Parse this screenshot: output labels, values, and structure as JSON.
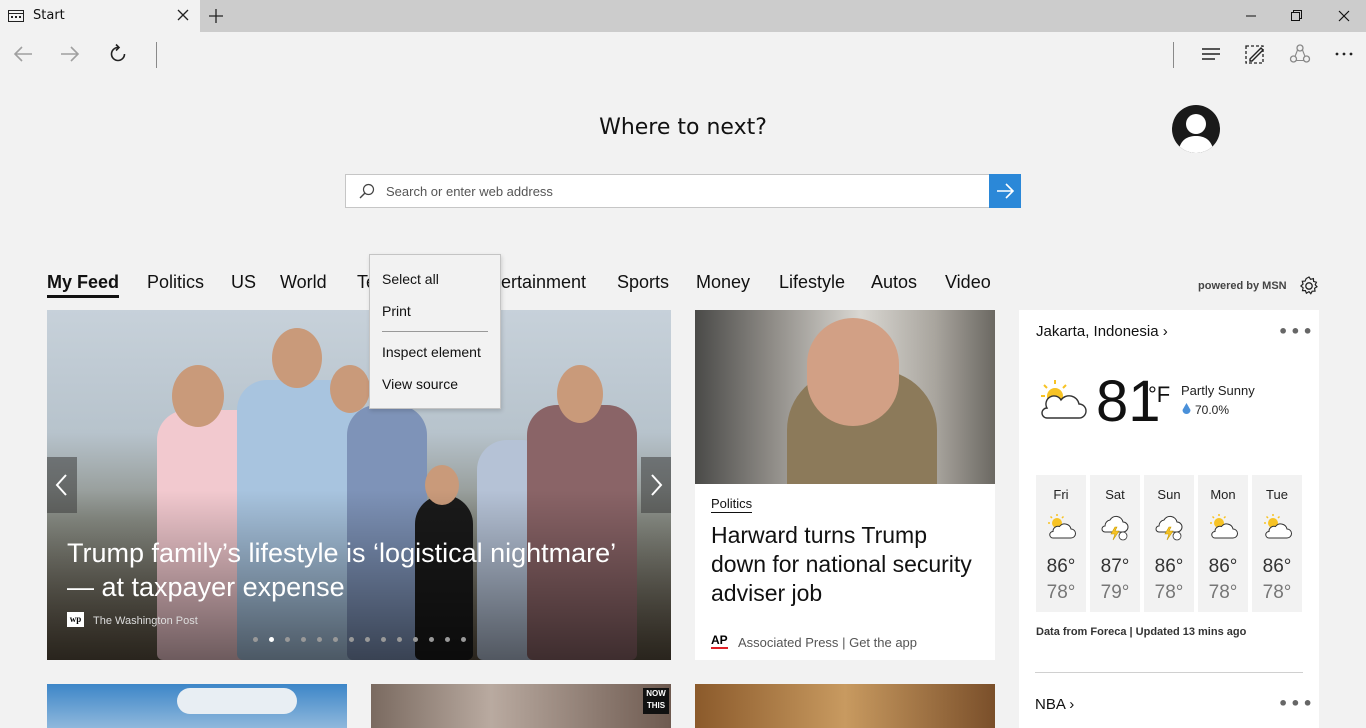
{
  "tab": {
    "title": "Start",
    "icon": "tab-page-icon"
  },
  "window": {
    "buttons": [
      "minimize-icon",
      "restore-icon",
      "close-icon"
    ]
  },
  "nav": {
    "icons": [
      "back-arrow-icon",
      "forward-arrow-icon",
      "refresh-icon",
      "hub-icon",
      "web-note-icon",
      "share-icon",
      "more-icon"
    ]
  },
  "page": {
    "heading": "Where to next?",
    "search": {
      "placeholder": "Search or enter web address"
    }
  },
  "feed_tabs": [
    "My Feed",
    "Politics",
    "US",
    "World",
    "Te",
    "ntertainment",
    "Sports",
    "Money",
    "Lifestyle",
    "Autos",
    "Video"
  ],
  "powered_by": "powered by MSN",
  "hero": {
    "title": "Trump family’s lifestyle is ‘logistical nightmare’ — at taxpayer expense",
    "source": "The Washington Post",
    "slide_count": 14,
    "active_slide": 1
  },
  "card2": {
    "category": "Politics",
    "title": "Harward turns Trump down for national security adviser job",
    "source_logo": "AP",
    "source": "Associated Press",
    "source_sep": "|",
    "get_app": "Get the app"
  },
  "weather": {
    "location": "Jakarta, Indonesia",
    "location_chevron": "›",
    "more": "•••",
    "temp": "81",
    "unit": "°F",
    "condition": "Partly Sunny",
    "humidity": "70.0%",
    "forecast": [
      {
        "day": "Fri",
        "hi": "86°",
        "lo": "78°",
        "icon": "partly-sunny-icon"
      },
      {
        "day": "Sat",
        "hi": "87°",
        "lo": "79°",
        "icon": "thunderstorm-icon"
      },
      {
        "day": "Sun",
        "hi": "86°",
        "lo": "78°",
        "icon": "thunderstorm-icon"
      },
      {
        "day": "Mon",
        "hi": "86°",
        "lo": "78°",
        "icon": "partly-sunny-icon"
      },
      {
        "day": "Tue",
        "hi": "86°",
        "lo": "78°",
        "icon": "partly-sunny-icon"
      }
    ],
    "footer": "Data from Foreca | Updated 13 mins ago",
    "next_section": "NBA",
    "next_chevron": "›"
  },
  "bottom_cards": {
    "card2_badge_top": "NOW",
    "card2_badge_bottom": "THIS"
  },
  "context_menu": {
    "items": [
      "Select all",
      "Print",
      "Inspect element",
      "View source"
    ]
  },
  "colors": {
    "accent": "#2b88d8",
    "tabstrip": "#cccccc",
    "page_bg": "#f2f2f2"
  }
}
